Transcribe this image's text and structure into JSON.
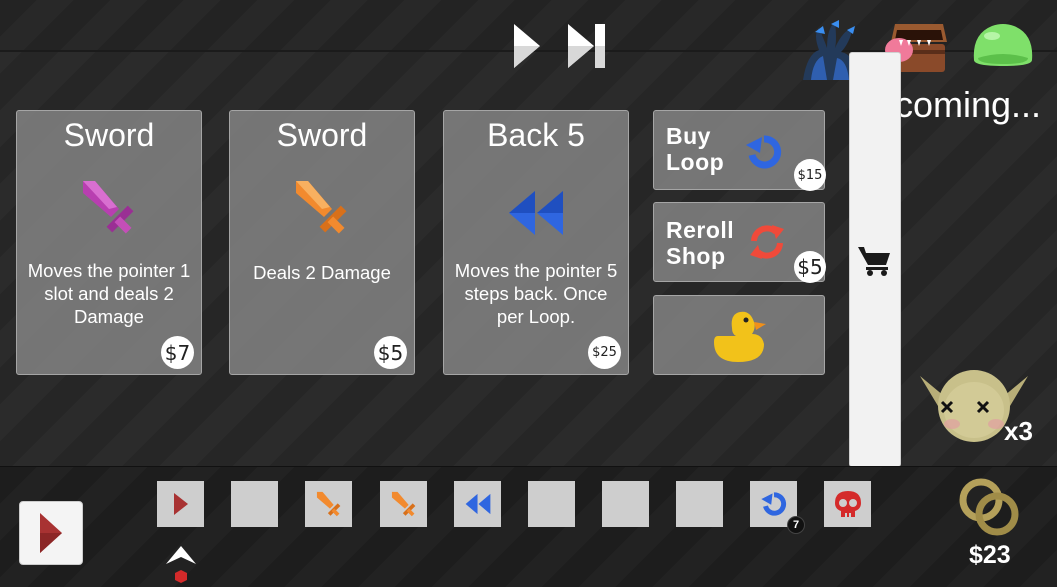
{
  "controls": {
    "play_icon": "play-icon",
    "fast_forward_icon": "fast-forward-icon"
  },
  "upcoming": {
    "label": "coming...",
    "enemies": [
      "hydra-icon",
      "mimic-chest-icon",
      "slime-icon"
    ]
  },
  "shop_cards": [
    {
      "title": "Sword",
      "description": "Moves the pointer 1 slot and deals 2 Damage",
      "price": "$7",
      "icon": "purple-sword-icon"
    },
    {
      "title": "Sword",
      "description": "Deals 2 Damage",
      "price": "$5",
      "icon": "orange-sword-icon"
    },
    {
      "title": "Back 5",
      "description": "Moves the pointer 5 steps back. Once per Loop.",
      "price": "$25",
      "icon": "rewind-icon"
    }
  ],
  "shop_buttons": {
    "buy_loop": {
      "label_line1": "Buy",
      "label_line2": "Loop",
      "price": "$15",
      "icon": "loop-icon"
    },
    "reroll": {
      "label_line1": "Reroll",
      "label_line2": "Shop",
      "price": "$5",
      "icon": "reroll-icon"
    },
    "duck": {
      "icon": "rubber-duck-icon"
    }
  },
  "side_panel": {
    "icon": "cart-icon"
  },
  "enemy": {
    "icon": "goblin-icon",
    "count": "x3"
  },
  "loop_slots": [
    {
      "icon": "play-arrow-icon"
    },
    {
      "icon": ""
    },
    {
      "icon": "orange-sword-icon"
    },
    {
      "icon": "orange-sword-icon"
    },
    {
      "icon": "rewind-icon"
    },
    {
      "icon": ""
    },
    {
      "icon": ""
    },
    {
      "icon": ""
    },
    {
      "icon": "loop-icon",
      "badge": "7"
    },
    {
      "icon": "skull-icon"
    }
  ],
  "player": {
    "money": "$23",
    "coin_icon": "coins-icon"
  },
  "colors": {
    "card_bg": "#8c8c8c",
    "purple_sword": "#c44fb8",
    "orange_sword": "#f28a2e",
    "blue_icon": "#2f66e0",
    "red_icon": "#f04a3a",
    "duck": "#f2c21a",
    "run_arrow": "#a83232",
    "skull": "#d42a2a"
  }
}
